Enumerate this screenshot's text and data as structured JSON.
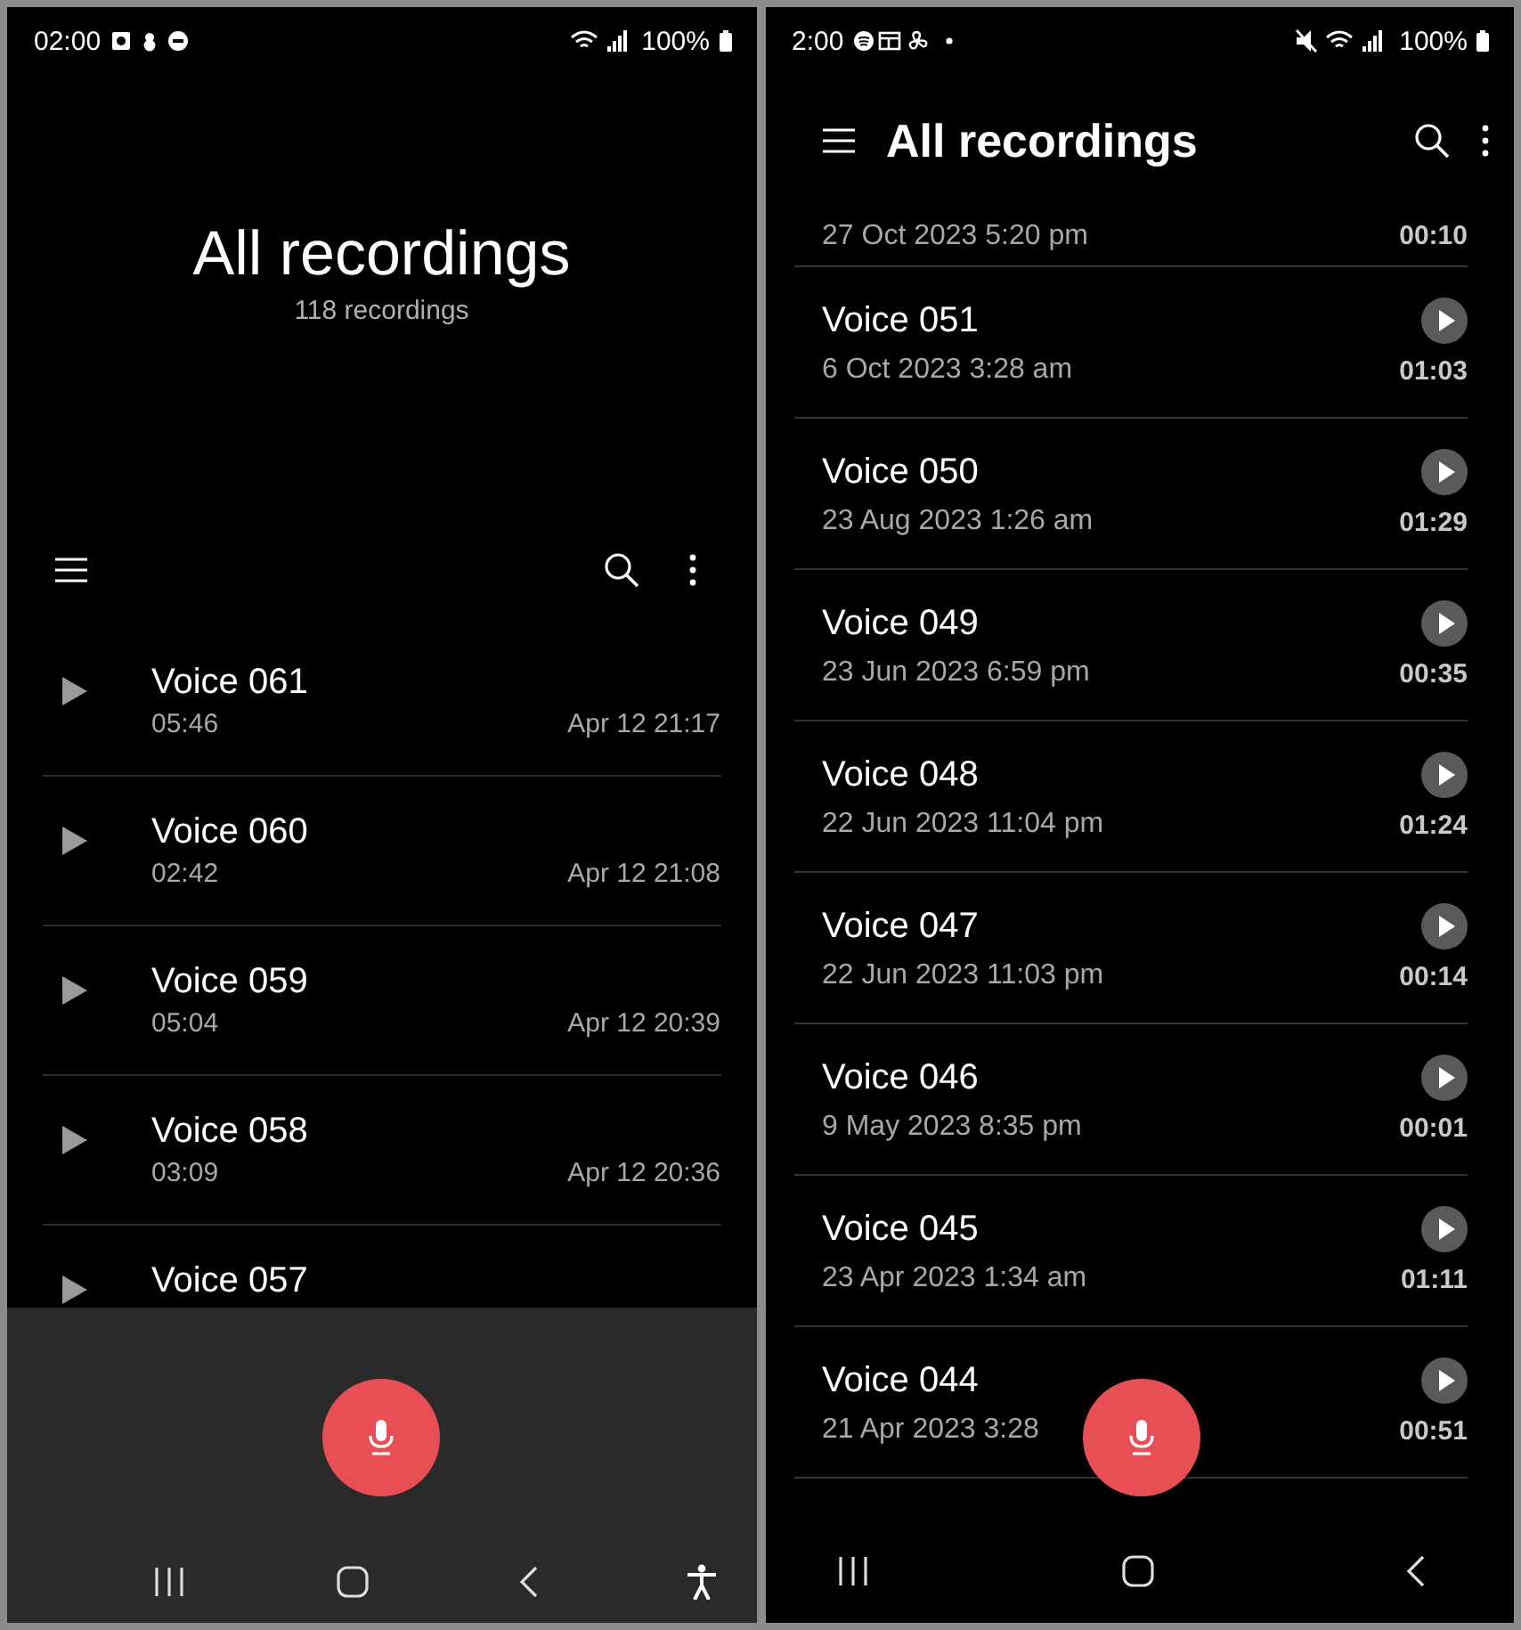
{
  "left_screen": {
    "status_bar": {
      "time": "02:00",
      "battery": "100%"
    },
    "title": "All recordings",
    "count": "118 recordings",
    "recordings": [
      {
        "name": "Voice 061",
        "duration": "05:46",
        "date": "Apr 12 21:17"
      },
      {
        "name": "Voice 060",
        "duration": "02:42",
        "date": "Apr 12 21:08"
      },
      {
        "name": "Voice 059",
        "duration": "05:04",
        "date": "Apr 12 20:39"
      },
      {
        "name": "Voice 058",
        "duration": "03:09",
        "date": "Apr 12 20:36"
      },
      {
        "name": "Voice 057"
      }
    ]
  },
  "right_screen": {
    "status_bar": {
      "time": "2:00",
      "battery": "100%"
    },
    "title": "All recordings",
    "partial_row": {
      "date": "27 Oct 2023 5:20 pm",
      "duration": "00:10"
    },
    "recordings": [
      {
        "name": "Voice 051",
        "date": "6 Oct 2023 3:28 am",
        "duration": "01:03"
      },
      {
        "name": "Voice 050",
        "date": "23 Aug 2023 1:26 am",
        "duration": "01:29"
      },
      {
        "name": "Voice 049",
        "date": "23 Jun 2023 6:59 pm",
        "duration": "00:35"
      },
      {
        "name": "Voice 048",
        "date": "22 Jun 2023 11:04 pm",
        "duration": "01:24"
      },
      {
        "name": "Voice 047",
        "date": "22 Jun 2023 11:03 pm",
        "duration": "00:14"
      },
      {
        "name": "Voice 046",
        "date": "9 May 2023 8:35 pm",
        "duration": "00:01"
      },
      {
        "name": "Voice 045",
        "date": "23 Apr 2023 1:34 am",
        "duration": "01:11"
      },
      {
        "name": "Voice 044",
        "date": "21 Apr 2023 3:28",
        "duration": "00:51"
      }
    ]
  }
}
